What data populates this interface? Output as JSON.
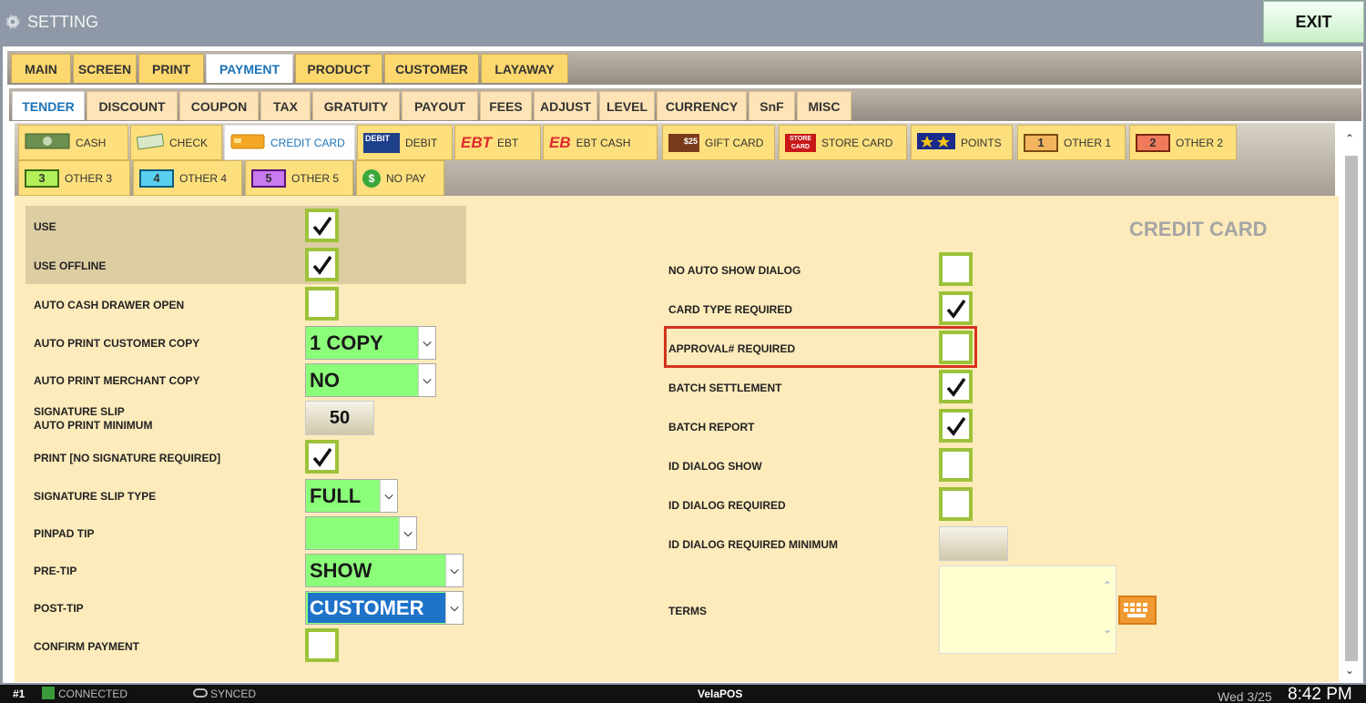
{
  "window": {
    "title": "SETTING",
    "exit_label": "EXIT"
  },
  "main_tabs": [
    "MAIN",
    "SCREEN",
    "PRINT",
    "PAYMENT",
    "PRODUCT",
    "CUSTOMER",
    "LAYAWAY"
  ],
  "main_active": "PAYMENT",
  "sub_tabs": [
    "TENDER",
    "DISCOUNT",
    "COUPON",
    "TAX",
    "GRATUITY",
    "PAYOUT",
    "FEES",
    "ADJUST",
    "LEVEL",
    "CURRENCY",
    "SnF",
    "MISC"
  ],
  "sub_active": "TENDER",
  "payment_types": {
    "cash": "CASH",
    "check": "CHECK",
    "credit_card": "CREDIT CARD",
    "debit": "DEBIT",
    "ebt": "EBT",
    "ebt_cash": "EBT CASH",
    "gift_card": "GIFT CARD",
    "store_card": "STORE CARD",
    "points": "POINTS",
    "other1": "OTHER 1",
    "other2": "OTHER 2",
    "other3": "OTHER 3",
    "other4": "OTHER 4",
    "other5": "OTHER 5",
    "no_pay": "NO PAY"
  },
  "icon_text": {
    "debit": "DEBIT",
    "ebt": "EBT",
    "ebt_cash": "EB",
    "gift": "$25",
    "store": "STORE CARD",
    "n1": "1",
    "n2": "2",
    "n3": "3",
    "n4": "4",
    "n5": "5",
    "nopay": "$"
  },
  "section_title": "CREDIT CARD",
  "left_settings": {
    "use": "USE",
    "use_offline": "USE OFFLINE",
    "auto_cash_drawer_open": "AUTO CASH DRAWER OPEN",
    "auto_print_customer_copy": "AUTO PRINT CUSTOMER COPY",
    "auto_print_merchant_copy": "AUTO PRINT MERCHANT COPY",
    "signature_slip_line1": "SIGNATURE SLIP",
    "signature_slip_line2": "AUTO PRINT MINIMUM",
    "print_no_signature": "PRINT [NO SIGNATURE REQUIRED]",
    "signature_slip_type": "SIGNATURE SLIP TYPE",
    "pinpad_tip": "PINPAD TIP",
    "pre_tip": "PRE-TIP",
    "post_tip": "POST-TIP",
    "confirm_payment": "CONFIRM PAYMENT"
  },
  "left_values": {
    "customer_copy": "1 COPY",
    "merchant_copy": "NO",
    "signature_min": "50",
    "slip_type": "FULL",
    "pinpad_tip": "",
    "pre_tip": "SHOW",
    "post_tip": "CUSTOMER"
  },
  "left_checks": {
    "use": true,
    "use_offline": true,
    "auto_cash_drawer_open": false,
    "print_no_signature": true,
    "confirm_payment": false
  },
  "right_settings": {
    "no_auto_show_dialog": "NO AUTO SHOW DIALOG",
    "card_type_required": "CARD TYPE REQUIRED",
    "approval_required": "APPROVAL# REQUIRED",
    "batch_settlement": "BATCH SETTLEMENT",
    "batch_report": "BATCH REPORT",
    "id_dialog_show": "ID DIALOG SHOW",
    "id_dialog_required": "ID DIALOG REQUIRED",
    "id_dialog_required_minimum": "ID DIALOG REQUIRED MINIMUM",
    "terms": "TERMS"
  },
  "right_checks": {
    "no_auto_show_dialog": false,
    "card_type_required": true,
    "approval_required": false,
    "batch_settlement": true,
    "batch_report": true,
    "id_dialog_show": false,
    "id_dialog_required": false
  },
  "right_values": {
    "id_dialog_min": "",
    "terms": ""
  },
  "status": {
    "station": "#1",
    "connected": "CONNECTED",
    "synced": "SYNCED",
    "app_name": "VelaPOS",
    "day": "Wed 3/25",
    "time": "8:42 PM"
  },
  "colors": {
    "highlight": "#d6321f",
    "checkbox_border": "#9cc23a",
    "select_bg": "#8cff7a",
    "tab_active_text": "#1b73b8"
  }
}
